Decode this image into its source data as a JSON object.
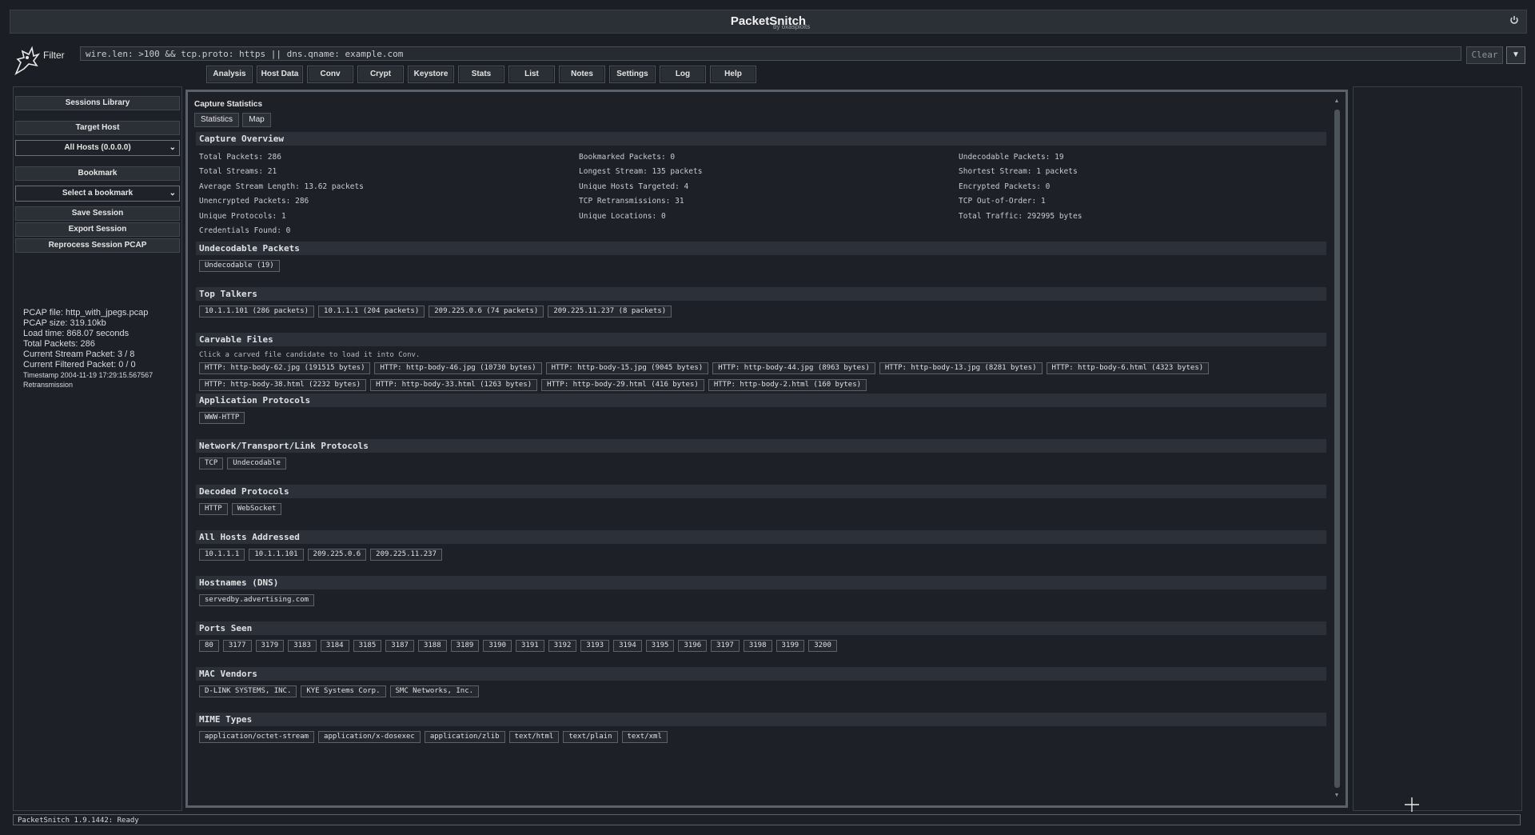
{
  "app": {
    "title": "PacketSnitch",
    "subtitle": "by oxasploits"
  },
  "filter": {
    "label": "Filter",
    "value": "wire.len: >100 && tcp.proto: https || dns.qname: example.com",
    "clear_label": "Clear"
  },
  "tabs": [
    "Analysis",
    "Host Data",
    "Conv",
    "Crypt",
    "Keystore",
    "Stats",
    "List",
    "Notes",
    "Settings",
    "Log",
    "Help"
  ],
  "sidebar": {
    "sessions_library": "Sessions Library",
    "target_host_label": "Target Host",
    "target_host_value": "All Hosts (0.0.0.0)",
    "bookmark_label": "Bookmark",
    "bookmark_value": "Select a bookmark",
    "save_session": "Save Session",
    "export_session": "Export Session",
    "reprocess": "Reprocess Session PCAP",
    "info": {
      "pcap_file": "PCAP file: http_with_jpegs.pcap",
      "pcap_size": "PCAP size: 319.10kb",
      "load_time": "Load time: 868.07 seconds",
      "total_packets": "Total Packets: 286",
      "current_stream": "Current Stream Packet: 3 / 8",
      "current_filtered": "Current Filtered Packet: 0 / 0",
      "timestamp": "Timestamp 2004-11-19 17:29:15.567567",
      "flag": "Retransmission"
    }
  },
  "main": {
    "title": "Capture Statistics",
    "subtabs": [
      "Statistics",
      "Map"
    ],
    "overview": {
      "header": "Capture Overview",
      "col1": [
        "Total Packets: 286",
        "Total Streams: 21",
        "Average Stream Length: 13.62 packets",
        "Unencrypted Packets: 286",
        "Unique Protocols: 1",
        "Credentials Found: 0"
      ],
      "col2": [
        "Bookmarked Packets: 0",
        "Longest Stream: 135 packets",
        "Unique Hosts Targeted: 4",
        "TCP Retransmissions: 31",
        "Unique Locations: 0"
      ],
      "col3": [
        "Undecodable Packets: 19",
        "Shortest Stream: 1 packets",
        "Encrypted Packets: 0",
        "TCP Out-of-Order: 1",
        "Total Traffic: 292995 bytes"
      ]
    },
    "sections": [
      {
        "header": "Undecodable Packets",
        "chips": [
          "Undecodable (19)"
        ]
      },
      {
        "header": "Top Talkers",
        "chips": [
          "10.1.1.101 (286 packets)",
          "10.1.1.1 (204 packets)",
          "209.225.0.6 (74 packets)",
          "209.225.11.237 (8 packets)"
        ]
      },
      {
        "header": "Carvable Files",
        "hint": "Click a carved file candidate to load it into Conv.",
        "chips": [
          "HTTP: http-body-62.jpg (191515 bytes)",
          "HTTP: http-body-46.jpg (10730 bytes)",
          "HTTP: http-body-15.jpg (9045 bytes)",
          "HTTP: http-body-44.jpg (8963 bytes)",
          "HTTP: http-body-13.jpg (8281 bytes)",
          "HTTP: http-body-6.html (4323 bytes)",
          "HTTP: http-body-38.html (2232 bytes)",
          "HTTP: http-body-33.html (1263 bytes)",
          "HTTP: http-body-29.html (416 bytes)",
          "HTTP: http-body-2.html (160 bytes)"
        ]
      },
      {
        "header": "Application Protocols",
        "chips": [
          "WWW-HTTP"
        ]
      },
      {
        "header": "Network/Transport/Link Protocols",
        "chips": [
          "TCP",
          "Undecodable"
        ]
      },
      {
        "header": "Decoded Protocols",
        "chips": [
          "HTTP",
          "WebSocket"
        ]
      },
      {
        "header": "All Hosts Addressed",
        "chips": [
          "10.1.1.1",
          "10.1.1.101",
          "209.225.0.6",
          "209.225.11.237"
        ]
      },
      {
        "header": "Hostnames (DNS)",
        "chips": [
          "servedby.advertising.com"
        ]
      },
      {
        "header": "Ports Seen",
        "chips": [
          "80",
          "3177",
          "3179",
          "3183",
          "3184",
          "3185",
          "3187",
          "3188",
          "3189",
          "3190",
          "3191",
          "3192",
          "3193",
          "3194",
          "3195",
          "3196",
          "3197",
          "3198",
          "3199",
          "3200"
        ]
      },
      {
        "header": "MAC Vendors",
        "chips": [
          "D-LINK SYSTEMS, INC.",
          "KYE Systems Corp.",
          "SMC Networks, Inc."
        ]
      },
      {
        "header": "MIME Types",
        "chips": [
          "application/octet-stream",
          "application/x-dosexec",
          "application/zlib",
          "text/html",
          "text/plain",
          "text/xml"
        ]
      }
    ]
  },
  "status": {
    "text": "PacketSnitch 1.9.1442: Ready"
  },
  "icons": {
    "power": "power-icon",
    "logo": "snitch-logo-icon",
    "dropdown": "chevron-down-icon",
    "cursor": "crosshair-cursor-icon"
  }
}
